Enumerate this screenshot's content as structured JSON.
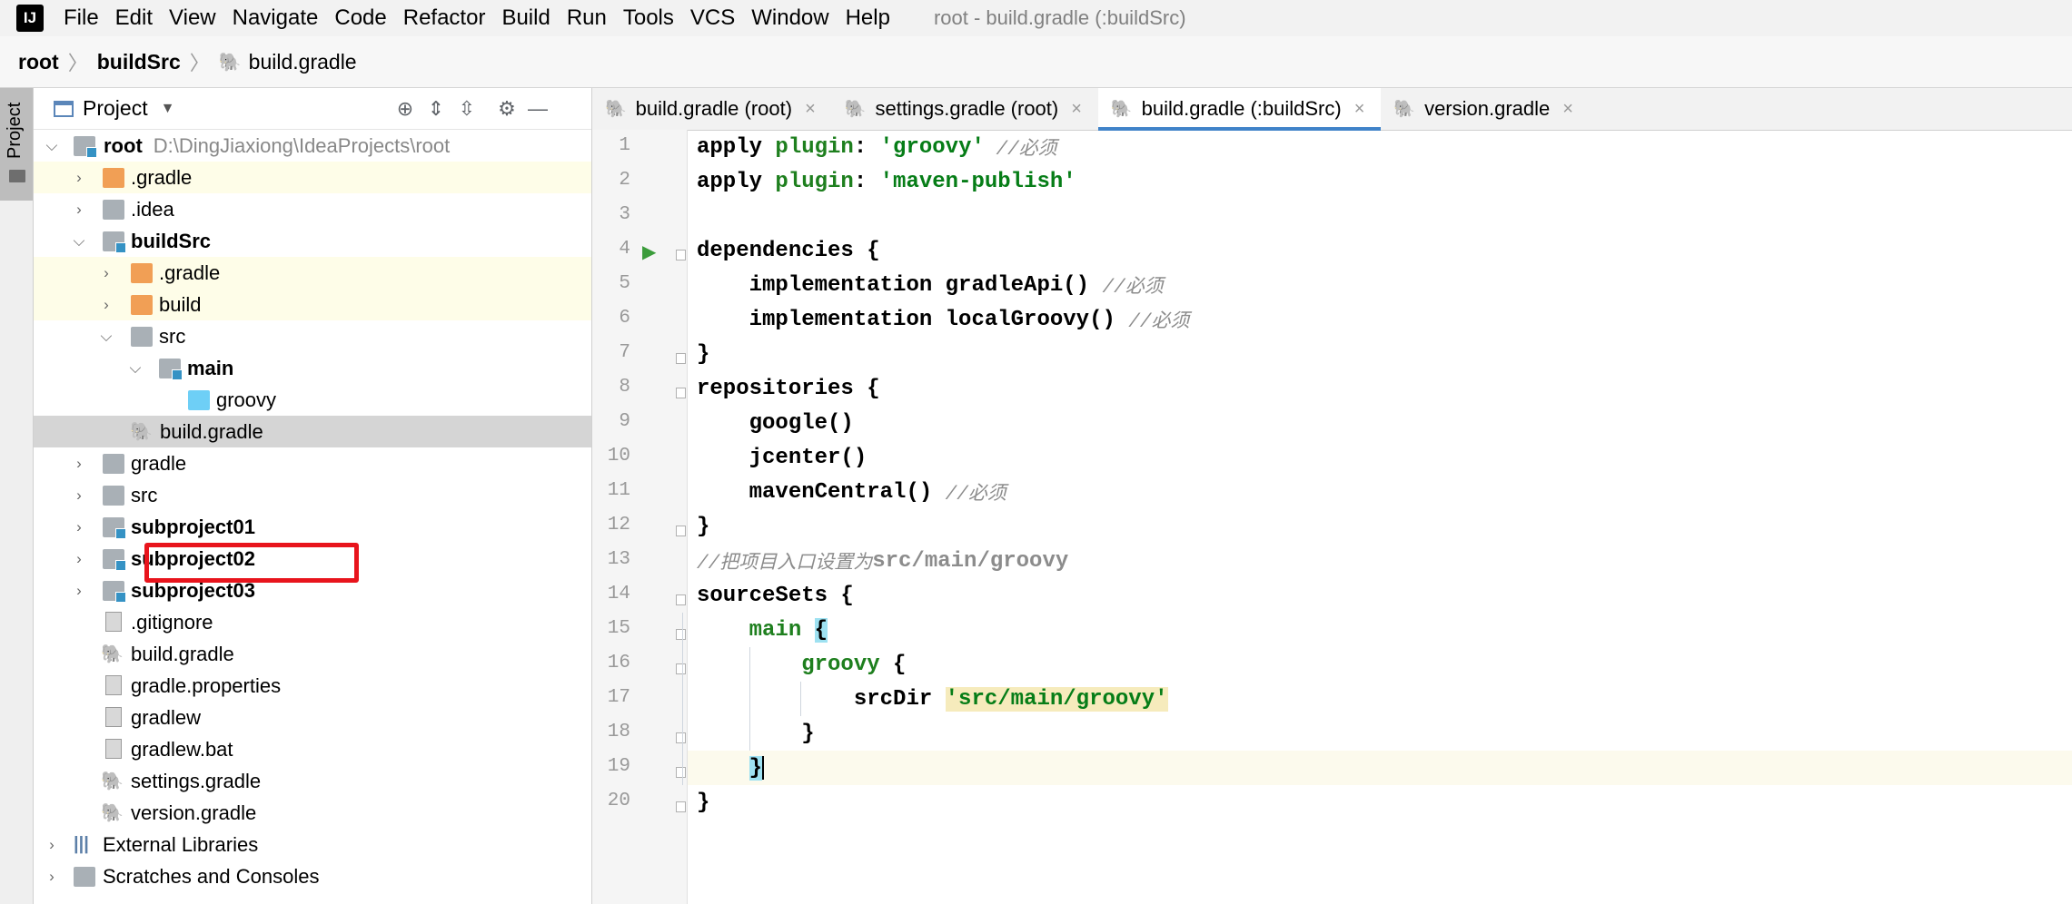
{
  "menubar": {
    "logo": "IJ",
    "items": [
      "File",
      "Edit",
      "View",
      "Navigate",
      "Code",
      "Refactor",
      "Build",
      "Run",
      "Tools",
      "VCS",
      "Window",
      "Help"
    ],
    "window_title": "root - build.gradle (:buildSrc)"
  },
  "breadcrumb": [
    "root",
    "buildSrc",
    "build.gradle"
  ],
  "left_strip": {
    "tab_label": "Project"
  },
  "project_panel": {
    "title": "Project",
    "tree": [
      {
        "label": "root",
        "path": "D:\\DingJiaxiong\\IdeaProjects\\root"
      },
      {
        "label": ".gradle"
      },
      {
        "label": ".idea"
      },
      {
        "label": "buildSrc"
      },
      {
        "label": ".gradle"
      },
      {
        "label": "build"
      },
      {
        "label": "src"
      },
      {
        "label": "main"
      },
      {
        "label": "groovy"
      },
      {
        "label": "build.gradle"
      },
      {
        "label": "gradle"
      },
      {
        "label": "src"
      },
      {
        "label": "subproject01"
      },
      {
        "label": "subproject02"
      },
      {
        "label": "subproject03"
      },
      {
        "label": ".gitignore"
      },
      {
        "label": "build.gradle"
      },
      {
        "label": "gradle.properties"
      },
      {
        "label": "gradlew"
      },
      {
        "label": "gradlew.bat"
      },
      {
        "label": "settings.gradle"
      },
      {
        "label": "version.gradle"
      },
      {
        "label": "External Libraries"
      },
      {
        "label": "Scratches and Consoles"
      }
    ]
  },
  "editor": {
    "tabs": [
      {
        "label": "build.gradle (root)"
      },
      {
        "label": "settings.gradle (root)"
      },
      {
        "label": "build.gradle (:buildSrc)"
      },
      {
        "label": "version.gradle"
      }
    ],
    "line_numbers": [
      "1",
      "2",
      "3",
      "4",
      "5",
      "6",
      "7",
      "8",
      "9",
      "10",
      "11",
      "12",
      "13",
      "14",
      "15",
      "16",
      "17",
      "18",
      "19",
      "20"
    ],
    "code": {
      "l1_a": "apply ",
      "l1_b": "plugin",
      "l1_c": ": ",
      "l1_d": "'groovy'",
      "l1_e": " //必须",
      "l2_a": "apply ",
      "l2_b": "plugin",
      "l2_c": ": ",
      "l2_d": "'maven-publish'",
      "l4": "dependencies {",
      "l5_a": "    implementation gradleApi() ",
      "l5_b": "//必须",
      "l6_a": "    implementation localGroovy() ",
      "l6_b": "//必须",
      "l7": "}",
      "l8": "repositories {",
      "l9": "    google()",
      "l10": "    jcenter()",
      "l11_a": "    mavenCentral() ",
      "l11_b": "//必须",
      "l12": "}",
      "l13_a": "//把项目入口设置为",
      "l13_b": "src/main/groovy",
      "l14": "sourceSets {",
      "l15_a": "    ",
      "l15_b": "main",
      "l15_c": " ",
      "l15_d": "{",
      "l16_a": "        ",
      "l16_b": "groovy",
      "l16_c": " {",
      "l17_a": "            srcDir ",
      "l17_b": "'src/main/groovy'",
      "l18": "        }",
      "l19_a": "    ",
      "l19_b": "}",
      "l20": "}"
    }
  }
}
